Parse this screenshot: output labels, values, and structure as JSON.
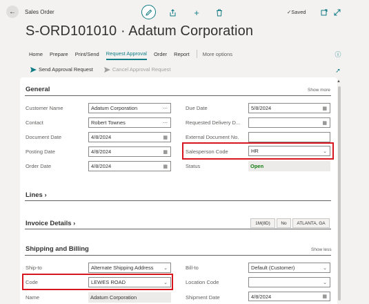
{
  "header": {
    "breadcrumb": "Sales Order",
    "saved_label": "Saved",
    "title": "S-ORD101010 · Adatum Corporation"
  },
  "tabs": [
    {
      "label": "Home"
    },
    {
      "label": "Prepare"
    },
    {
      "label": "Print/Send"
    },
    {
      "label": "Request Approval"
    },
    {
      "label": "Order"
    },
    {
      "label": "Report"
    }
  ],
  "more_options": "More options",
  "subactions": {
    "send": "Send Approval Request",
    "cancel": "Cancel Approval Request"
  },
  "general": {
    "title": "General",
    "toggle": "Show more",
    "customer_name": {
      "label": "Customer Name",
      "value": "Adatum Corporation"
    },
    "contact": {
      "label": "Contact",
      "value": "Robert Townes"
    },
    "document_date": {
      "label": "Document Date",
      "value": "4/8/2024"
    },
    "posting_date": {
      "label": "Posting Date",
      "value": "4/8/2024"
    },
    "order_date": {
      "label": "Order Date",
      "value": "4/8/2024"
    },
    "due_date": {
      "label": "Due Date",
      "value": "5/8/2024"
    },
    "requested_delivery": {
      "label": "Requested Delivery D...",
      "value": ""
    },
    "external_doc": {
      "label": "External Document No.",
      "value": ""
    },
    "salesperson": {
      "label": "Salesperson Code",
      "value": "HR"
    },
    "status": {
      "label": "Status",
      "value": "Open"
    }
  },
  "lines": {
    "title": "Lines"
  },
  "invoice": {
    "title": "Invoice Details",
    "pills": [
      "1M(8D)",
      "No",
      "ATLANTA, GA"
    ]
  },
  "shipping": {
    "title": "Shipping and Billing",
    "toggle": "Show less",
    "ship_to": {
      "label": "Ship-to",
      "value": "Alternate Shipping Address"
    },
    "code": {
      "label": "Code",
      "value": "LEWES ROAD"
    },
    "name": {
      "label": "Name",
      "value": "Adatum Corporation"
    },
    "bill_to": {
      "label": "Bill-to",
      "value": "Default (Customer)"
    },
    "location_code": {
      "label": "Location Code",
      "value": ""
    },
    "shipment_date": {
      "label": "Shipment Date",
      "value": "4/8/2024"
    }
  },
  "colors": {
    "accent": "#0f7b84",
    "highlight": "#d7151f",
    "status_open": "#107c10"
  }
}
